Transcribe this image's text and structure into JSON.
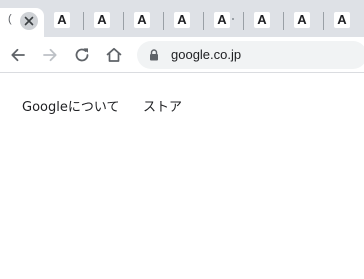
{
  "tabs": {
    "active": {
      "title_fragment": "("
    },
    "inactive_favicon_letter": "A",
    "inactive_count": 8
  },
  "toolbar": {
    "url": "google.co.jp"
  },
  "page": {
    "links": [
      "Googleについて",
      "ストア"
    ]
  },
  "colors": {
    "tabstrip_bg": "#dee1e6",
    "omnibox_bg": "#f1f3f4",
    "icon": "#5f6368",
    "text": "#202124"
  }
}
